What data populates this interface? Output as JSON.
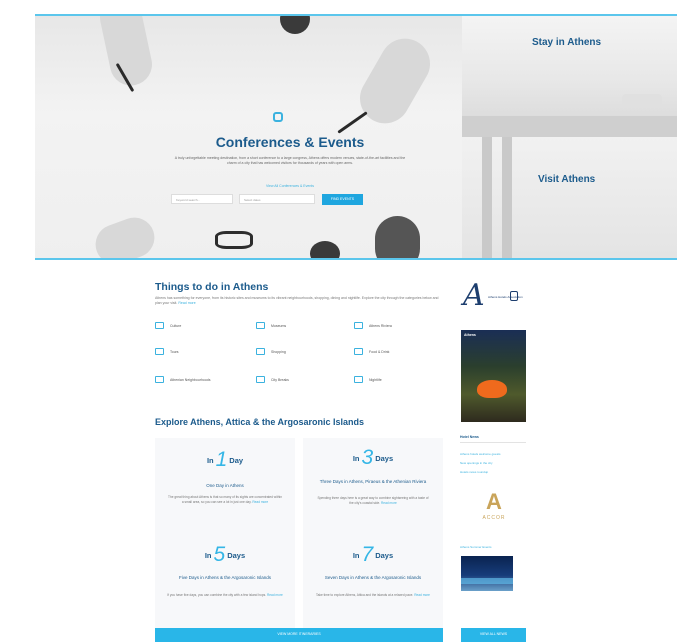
{
  "hero": {
    "title": "Conferences & Events",
    "paragraph": "A truly unforgettable meeting destination, from a short conference to a large congress, Athens offers modern venues, state-of-the-art facilities and the charm of a city that has welcomed visitors for thousands of years with open arms.",
    "link": "View All Conferences & Events",
    "search_placeholder": "Keyword search...",
    "date_placeholder": "Select dates",
    "button": "FIND EVENTS"
  },
  "panels": {
    "stay": "Stay in Athens",
    "visit": "Visit Athens"
  },
  "things": {
    "title": "Things to do in Athens",
    "paragraph": "Athens has something for everyone, from its historic sites and museums to its vibrant neighbourhoods, shopping, dining and nightlife. Explore the city through the categories below and plan your visit.",
    "more": "Read more",
    "categories": [
      "Culture",
      "Museums",
      "Athens Riviera",
      "Tours",
      "Shopping",
      "Food & Drink",
      "Athenian Neighbourhoods",
      "City Breaks",
      "Nightlife"
    ]
  },
  "explore": {
    "title": "Explore Athens, Attica & the Argosaronic Islands",
    "in_label": "In",
    "cards": [
      {
        "num": "1",
        "unit": "Day",
        "sub": "One Day in Athens",
        "desc": "The great thing about Athens is that so many of its sights are concentrated within a small area, so you can see a lot in just one day.",
        "more": "Read more"
      },
      {
        "num": "3",
        "unit": "Days",
        "sub": "Three Days in Athens, Piraeus & the Athenian Riviera",
        "desc": "Spending three days here is a great way to combine sightseeing with a taste of the city's coastal side.",
        "more": "Read more"
      },
      {
        "num": "5",
        "unit": "Days",
        "sub": "Five Days in Athens & the Argosaronic Islands",
        "desc": "If you have five days, you can combine the city with a few island hops.",
        "more": "Read more"
      },
      {
        "num": "7",
        "unit": "Days",
        "sub": "Seven Days in Athens & the Argosaronic Islands",
        "desc": "Take time to explore Athens, Attica and the islands at a relaxed pace.",
        "more": "Read more"
      }
    ],
    "bar_button": "VIEW MORE ITINERARIES"
  },
  "sidebar": {
    "logo_text": "Athens Hotels Association",
    "ad_text": "Athens",
    "head": "Hotel News",
    "links": [
      "Athens hotels welcome guests",
      "New openings in the city",
      "Hotels news roundup"
    ],
    "accor_word": "ACCOR",
    "photo_link": "Athens Summer Events",
    "button": "VIEW ALL NEWS"
  }
}
